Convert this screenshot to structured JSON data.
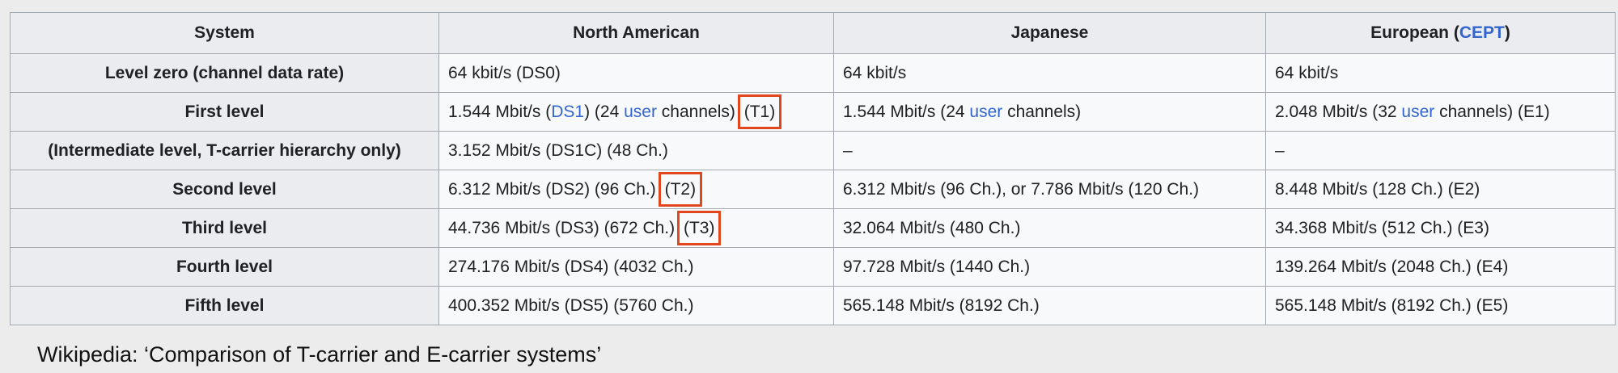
{
  "table": {
    "headers": {
      "system": "System",
      "north_american": "North American",
      "japanese": "Japanese",
      "european_prefix": "European (",
      "european_link": "CEPT",
      "european_suffix": ")"
    },
    "rows": [
      {
        "level": "Level zero (channel data rate)",
        "na": {
          "text": "64 kbit/s (DS0)"
        },
        "jp": {
          "text": "64 kbit/s"
        },
        "eu": {
          "text": "64 kbit/s"
        }
      },
      {
        "level": "First level",
        "na": {
          "pre": "1.544 Mbit/s (",
          "link1": "DS1",
          "mid": ") (24 ",
          "link2": "user",
          "post": " channels) ",
          "highlight": "(T1)"
        },
        "jp": {
          "pre": "1.544 Mbit/s (24 ",
          "link": "user",
          "post": " channels)"
        },
        "eu": {
          "pre": "2.048 Mbit/s (32 ",
          "link": "user",
          "post": " channels) (E1)"
        }
      },
      {
        "level": "(Intermediate level, T-carrier hierarchy only)",
        "na": {
          "text": "3.152 Mbit/s (DS1C) (48 Ch.)"
        },
        "jp": {
          "text": "–"
        },
        "eu": {
          "text": "–"
        }
      },
      {
        "level": "Second level",
        "na": {
          "pre": "6.312 Mbit/s (DS2) (96 Ch.) ",
          "highlight": "(T2)"
        },
        "jp": {
          "text": "6.312 Mbit/s (96 Ch.), or 7.786 Mbit/s (120 Ch.)"
        },
        "eu": {
          "text": "8.448 Mbit/s (128 Ch.) (E2)"
        }
      },
      {
        "level": "Third level",
        "na": {
          "pre": "44.736 Mbit/s (DS3) (672 Ch.) ",
          "highlight": "(T3)"
        },
        "jp": {
          "text": "32.064 Mbit/s (480 Ch.)"
        },
        "eu": {
          "text": "34.368 Mbit/s (512 Ch.) (E3)"
        }
      },
      {
        "level": "Fourth level",
        "na": {
          "text": "274.176 Mbit/s (DS4) (4032 Ch.)"
        },
        "jp": {
          "text": "97.728 Mbit/s (1440 Ch.)"
        },
        "eu": {
          "text": "139.264 Mbit/s (2048 Ch.) (E4)"
        }
      },
      {
        "level": "Fifth level",
        "na": {
          "text": "400.352 Mbit/s (DS5) (5760 Ch.)"
        },
        "jp": {
          "text": "565.148 Mbit/s (8192 Ch.)"
        },
        "eu": {
          "text": "565.148 Mbit/s (8192 Ch.) (E5)"
        }
      }
    ]
  },
  "caption": "Wikipedia: ‘Comparison of T-carrier and E-carrier systems’",
  "colors": {
    "link": "#3366cc",
    "highlight_box": "#e2461d",
    "header_bg": "#eaecf0",
    "cell_bg": "#f8f9fa",
    "border": "#a2a9b1"
  }
}
